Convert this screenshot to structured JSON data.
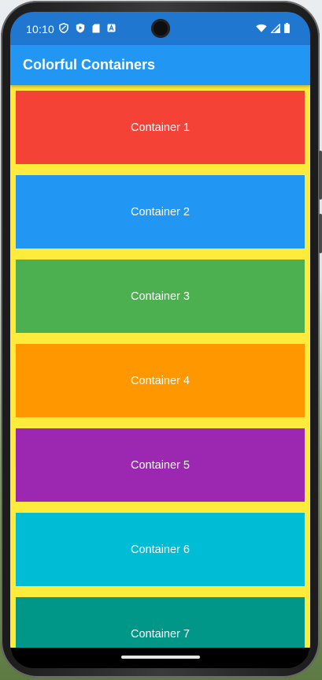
{
  "status_bar": {
    "time": "10:10",
    "left_icons": [
      "location-shield-icon",
      "play-protect-icon",
      "sim-card-icon",
      "font-a-icon"
    ],
    "right_icons": [
      "wifi-icon",
      "signal-icon",
      "battery-icon"
    ]
  },
  "app_bar": {
    "title": "Colorful Containers",
    "color": "#2196f3"
  },
  "list_background": "#ffeb3b",
  "containers": [
    {
      "label": "Container 1",
      "color": "#f44336"
    },
    {
      "label": "Container 2",
      "color": "#2196f3"
    },
    {
      "label": "Container 3",
      "color": "#4caf50"
    },
    {
      "label": "Container 4",
      "color": "#ff9800"
    },
    {
      "label": "Container 5",
      "color": "#9c27b0"
    },
    {
      "label": "Container 6",
      "color": "#00bcd4"
    },
    {
      "label": "Container 7",
      "color": "#009688"
    }
  ]
}
